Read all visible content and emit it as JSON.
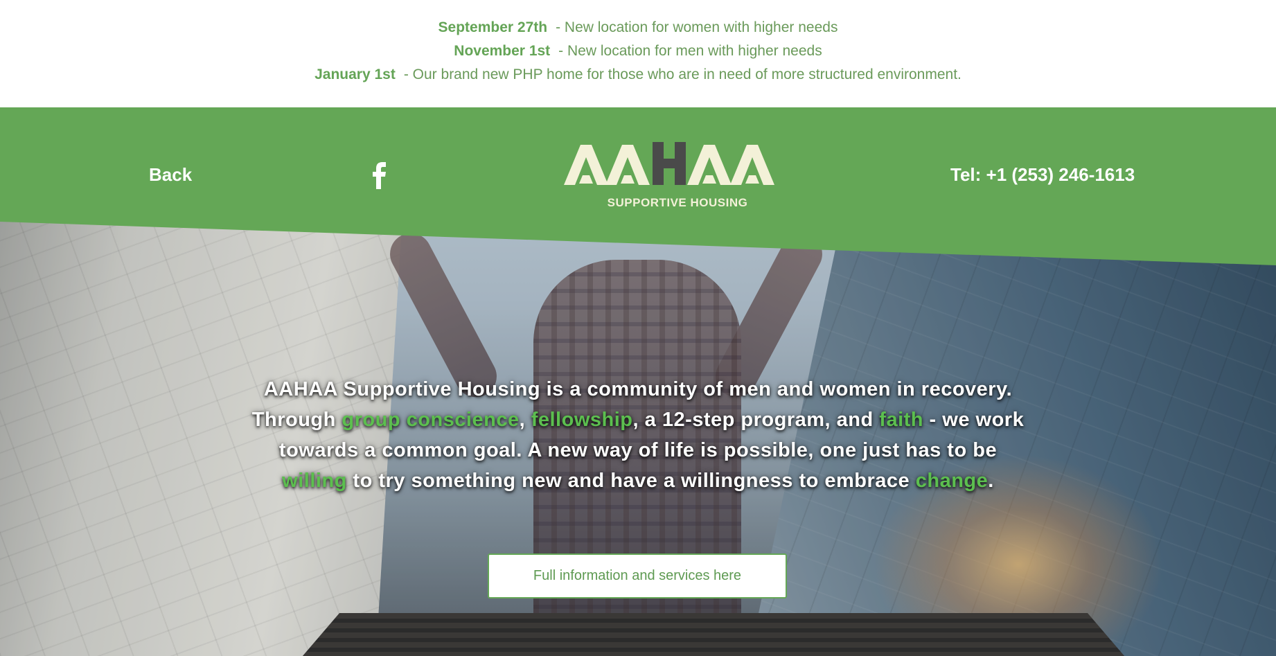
{
  "announcements": [
    {
      "date": "September 27th",
      "text": "- New location for women with higher needs"
    },
    {
      "date": "November 1st",
      "text": "- New location for men with higher needs"
    },
    {
      "date": "January 1st",
      "text": "- Our brand new PHP home for those who are in need of more structured environment."
    }
  ],
  "header": {
    "back_label": "Back",
    "facebook_icon": "facebook-icon",
    "logo_text": "AAHAA",
    "logo_tm": "™",
    "logo_subtitle": "SUPPORTIVE HOUSING",
    "phone": "Tel: +1 (253) 246-1613"
  },
  "hero": {
    "p1": "AAHAA Supportive Housing is a community of men and women in recovery. Through ",
    "hl1": "group conscience",
    "p2": ", ",
    "hl2": "fellowship",
    "p3": ", a 12-step program, and ",
    "hl3": "faith",
    "p4": " - we work towards a common goal. A new way of life is possible, one just has to be ",
    "hl4": "willing",
    "p5": " to try something new and have a willingness to embrace ",
    "hl5": "change",
    "p6": ".",
    "cta_label": "Full information and services here"
  },
  "colors": {
    "brand_green": "#64a756",
    "highlight_green": "#5cbf4f",
    "logo_cream": "#f3f1d8",
    "logo_dark": "#4a4a4a"
  }
}
